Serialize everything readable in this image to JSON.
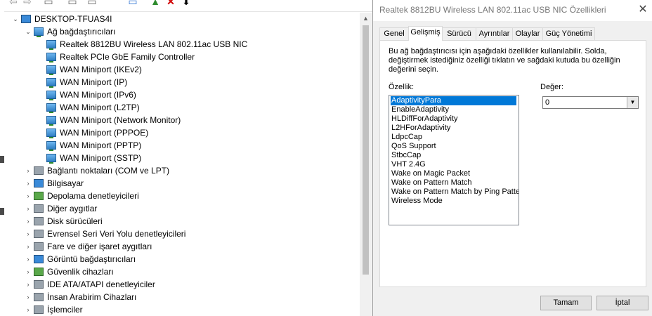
{
  "device_manager": {
    "root": "DESKTOP-TFUAS4I",
    "network_category": "Ağ bağdaştırıcıları",
    "network_items": [
      "Realtek 8812BU Wireless LAN 802.11ac USB NIC",
      "Realtek PCIe GbE Family Controller",
      "WAN Miniport (IKEv2)",
      "WAN Miniport (IP)",
      "WAN Miniport (IPv6)",
      "WAN Miniport (L2TP)",
      "WAN Miniport (Network Monitor)",
      "WAN Miniport (PPPOE)",
      "WAN Miniport (PPTP)",
      "WAN Miniport (SSTP)"
    ],
    "categories": [
      "Bağlantı noktaları (COM ve LPT)",
      "Bilgisayar",
      "Depolama denetleyicileri",
      "Diğer aygıtlar",
      "Disk sürücüleri",
      "Evrensel Seri Veri Yolu denetleyicileri",
      "Fare ve diğer işaret aygıtları",
      "Görüntü bağdaştırıcıları",
      "Güvenlik cihazları",
      "IDE ATA/ATAPI denetleyiciler",
      "İnsan Arabirim Cihazları",
      "İşlemciler"
    ]
  },
  "dialog": {
    "title": "Realtek 8812BU Wireless LAN 802.11ac USB NIC Özellikleri",
    "tabs": [
      "Genel",
      "Gelişmiş",
      "Sürücü",
      "Ayrıntılar",
      "Olaylar",
      "Güç Yönetimi"
    ],
    "active_tab": "Gelişmiş",
    "description": "Bu ağ bağdaştırıcısı için aşağıdaki özellikler kullanılabilir. Solda, değiştirmek istediğiniz özelliği tıklatın ve sağdaki kutuda bu özelliğin değerini seçin.",
    "property_label": "Özellik:",
    "properties": [
      "AdaptivityPara",
      "EnableAdaptivity",
      "HLDiffForAdaptivity",
      "L2HForAdaptivity",
      "LdpcCap",
      "QoS Support",
      "StbcCap",
      "VHT 2.4G",
      "Wake on Magic Packet",
      "Wake on Pattern Match",
      "Wake on Pattern Match by Ping Patte",
      "Wireless Mode"
    ],
    "selected_property": "AdaptivityPara",
    "value_label": "Değer:",
    "value": "0",
    "ok_label": "Tamam",
    "cancel_label": "İptal"
  },
  "colors": {
    "selection": "#0078d7",
    "dialog_bg": "#f0f0f0",
    "title_text": "#777777"
  }
}
